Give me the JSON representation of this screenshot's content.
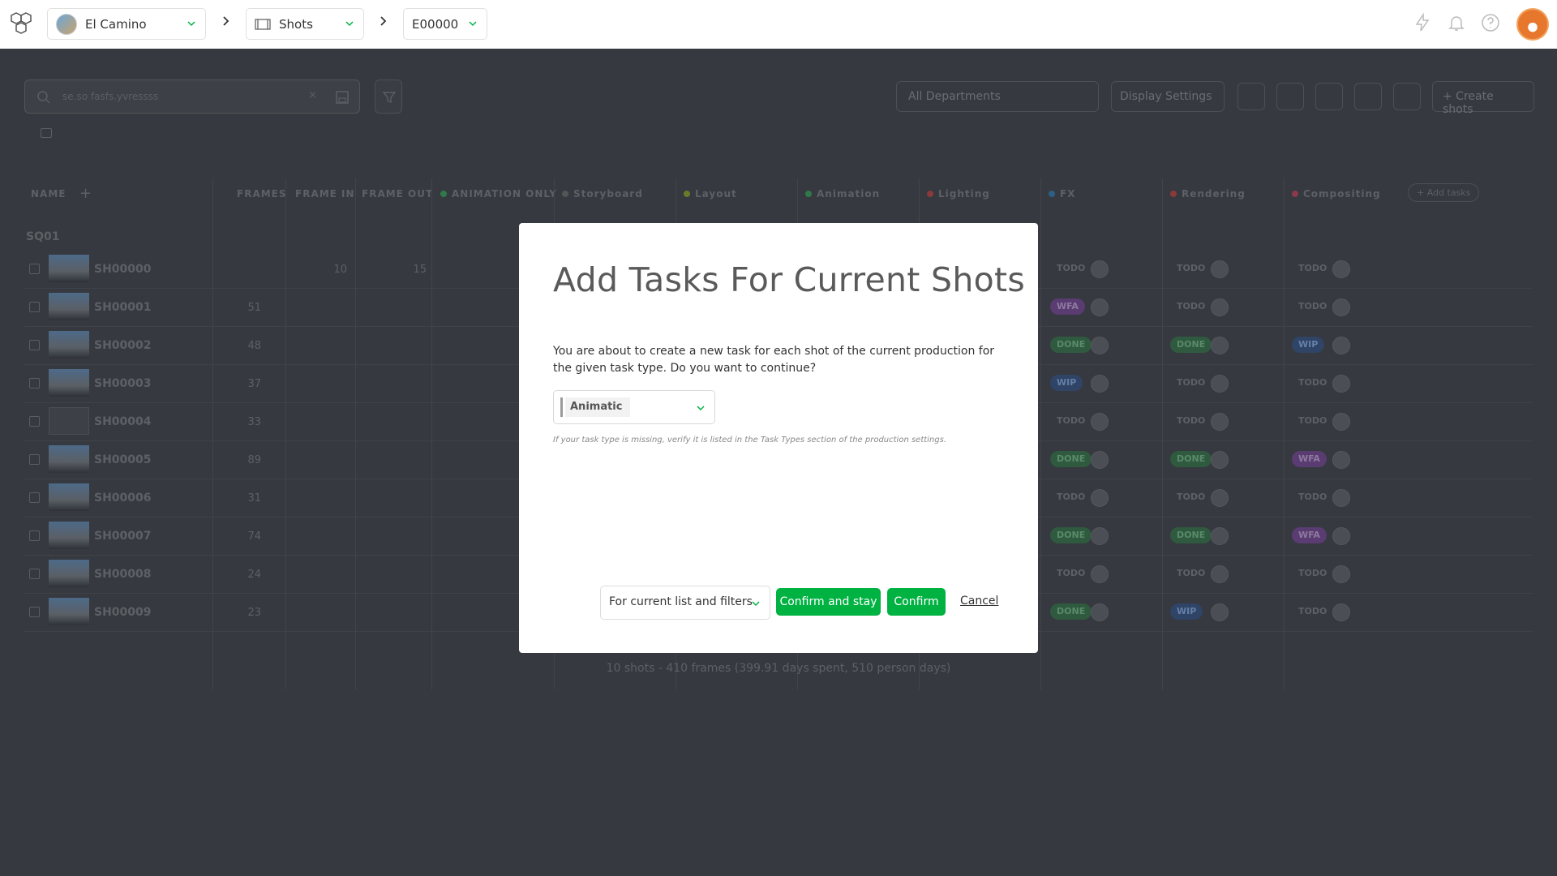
{
  "topbar": {
    "production": "El Camino",
    "section": "Shots",
    "episode": "E00000"
  },
  "toolbar": {
    "search_placeholder": "se.so fasfs.yvressss",
    "department": "All Departments",
    "display_settings": "Display Settings",
    "create_shots": "+ Create shots"
  },
  "table": {
    "headers": {
      "name": "NAME",
      "frames": "FRAMES",
      "frame_in": "FRAME IN",
      "frame_out": "FRAME OUT",
      "animation_only": "ANIMATION ONLY",
      "storyboard": "Storyboard",
      "layout": "Layout",
      "animation": "Animation",
      "lighting": "Lighting",
      "fx": "FX",
      "rendering": "Rendering",
      "compositing": "Compositing",
      "add_tasks": "+ Add tasks"
    },
    "sequence": "SQ01",
    "rows": [
      {
        "name": "SH00000",
        "frames": "",
        "fin": "10",
        "fout": "15",
        "fx": "TODO",
        "rend": "TODO",
        "comp": "TODO"
      },
      {
        "name": "SH00001",
        "frames": "51",
        "fin": "",
        "fout": "",
        "fx": "WFA",
        "rend": "TODO",
        "comp": "TODO"
      },
      {
        "name": "SH00002",
        "frames": "48",
        "fin": "",
        "fout": "",
        "fx": "DONE",
        "rend": "DONE",
        "comp": "WIP"
      },
      {
        "name": "SH00003",
        "frames": "37",
        "fin": "",
        "fout": "",
        "fx": "WIP",
        "rend": "TODO",
        "comp": "TODO"
      },
      {
        "name": "SH00004",
        "frames": "33",
        "fin": "",
        "fout": "",
        "fx": "TODO",
        "rend": "TODO",
        "comp": "TODO"
      },
      {
        "name": "SH00005",
        "frames": "89",
        "fin": "",
        "fout": "",
        "fx": "DONE",
        "rend": "DONE",
        "comp": "WFA"
      },
      {
        "name": "SH00006",
        "frames": "31",
        "fin": "",
        "fout": "",
        "fx": "TODO",
        "rend": "TODO",
        "comp": "TODO"
      },
      {
        "name": "SH00007",
        "frames": "74",
        "fin": "",
        "fout": "",
        "fx": "DONE",
        "rend": "DONE",
        "comp": "WFA"
      },
      {
        "name": "SH00008",
        "frames": "24",
        "fin": "",
        "fout": "",
        "fx": "TODO",
        "rend": "TODO",
        "comp": "TODO"
      },
      {
        "name": "SH00009",
        "frames": "23",
        "fin": "",
        "fout": "",
        "fx": "DONE",
        "rend": "WIP",
        "comp": "TODO"
      }
    ],
    "footer": "10 shots - 410 frames (399.91 days spent, 510 person days)"
  },
  "modal": {
    "title": "Add Tasks For Current Shots",
    "text": "You are about to create a new task for each shot of the current production for the given task type. Do you want to continue?",
    "task_type": "Animatic",
    "hint": "If your task type is missing, verify it is listed in the Task Types section of the production settings.",
    "scope": "For current list and filters",
    "confirm_stay": "Confirm and stay",
    "confirm": "Confirm",
    "cancel": "Cancel"
  },
  "colors": {
    "confirm_green": "#00b242",
    "background": "#36393f"
  }
}
